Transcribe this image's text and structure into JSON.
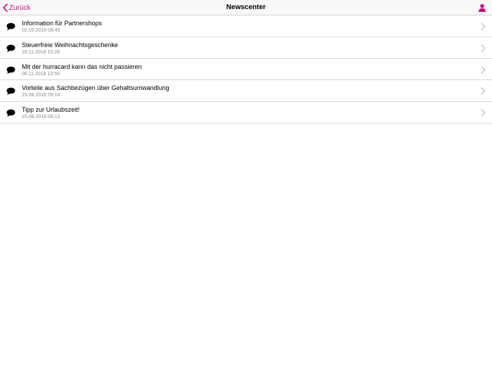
{
  "nav": {
    "back_label": "Zurück",
    "title": "Newscenter",
    "accent_color": "#c2127d"
  },
  "icons": {
    "back": "chevron-left-icon",
    "profile": "person-icon",
    "item": "speech-bubble-icon",
    "disclosure": "chevron-right-icon"
  },
  "news": [
    {
      "title": "Information für Partnershops",
      "date": "02.03.2019 08:45"
    },
    {
      "title": "Steuerfreie Weihnachtsgeschenke",
      "date": "16.11.2018 10:26"
    },
    {
      "title": "Mit der hurracard kann das nicht passieren",
      "date": "06.11.2018 13:59"
    },
    {
      "title": "Vorteile aus Sachbezügen über Gehaltsumwandlung",
      "date": "15.08.2018 09:14"
    },
    {
      "title": "Tipp zur Urlaubszeit!",
      "date": "15.08.2018 09:12"
    }
  ]
}
